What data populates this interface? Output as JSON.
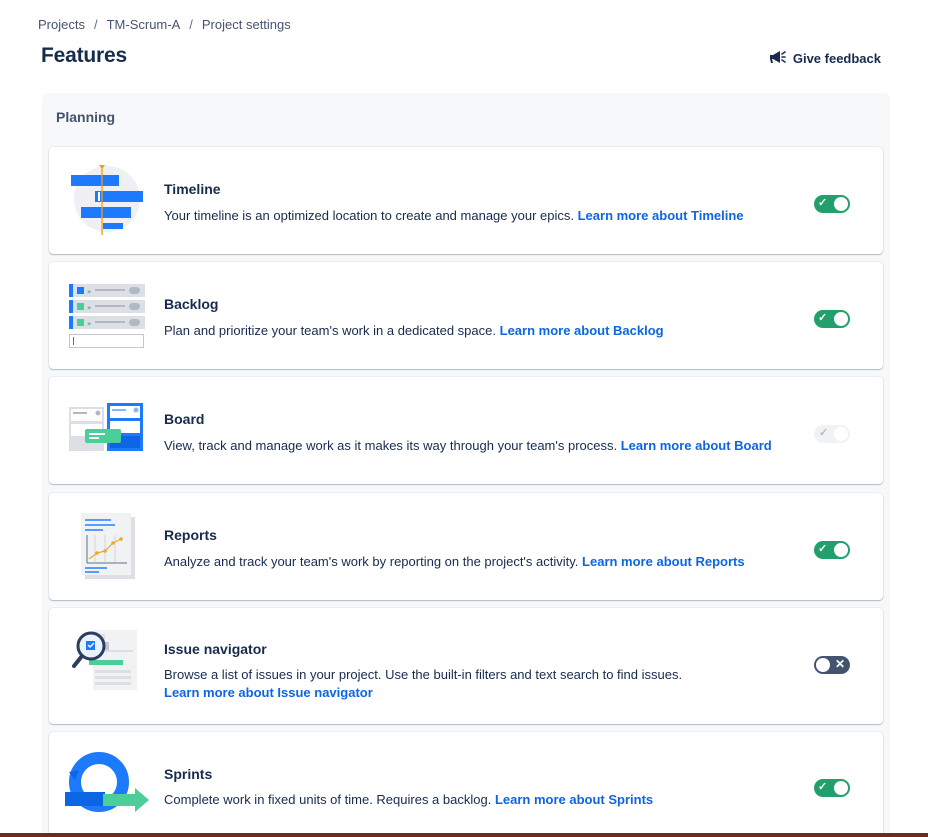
{
  "breadcrumb": [
    {
      "label": "Projects"
    },
    {
      "label": "TM-Scrum-A"
    },
    {
      "label": "Project settings"
    }
  ],
  "breadcrumb_separator": "/",
  "page": {
    "title": "Features"
  },
  "feedback": {
    "label": "Give feedback",
    "icon": "megaphone-icon"
  },
  "section": {
    "title": "Planning"
  },
  "features": [
    {
      "title": "Timeline",
      "description": "Your timeline is an optimized location to create and manage your epics.",
      "link": "Learn more about Timeline",
      "toggle": "on",
      "toggle_mark": "✓"
    },
    {
      "title": "Backlog",
      "description": "Plan and prioritize your team's work in a dedicated space.",
      "link": "Learn more about Backlog",
      "toggle": "on",
      "toggle_mark": "✓"
    },
    {
      "title": "Board",
      "description": "View, track and manage work as it makes its way through your team's process.",
      "link": "Learn more about Board",
      "toggle": "disabled-on",
      "toggle_mark": "✓"
    },
    {
      "title": "Reports",
      "description": "Analyze and track your team's work by reporting on the project's activity.",
      "link": "Learn more about Reports",
      "toggle": "on",
      "toggle_mark": "✓"
    },
    {
      "title": "Issue navigator",
      "description": "Browse a list of issues in your project. Use the built-in filters and text search to find issues.",
      "link": "Learn more about Issue navigator",
      "toggle": "off",
      "toggle_mark": "✕"
    },
    {
      "title": "Sprints",
      "description": "Complete work in fixed units of time. Requires a backlog.",
      "link": "Learn more about Sprints",
      "toggle": "on",
      "toggle_mark": "✓"
    }
  ],
  "colors": {
    "toggle_on": "#22a06b",
    "toggle_off": "#44546f",
    "link": "#0c66e4",
    "text": "#172b4d"
  }
}
